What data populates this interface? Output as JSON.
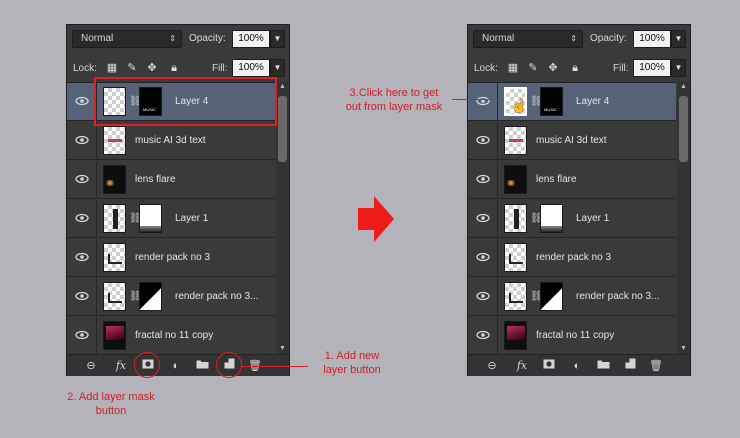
{
  "colors": {
    "annotation": "#dd1f26",
    "panel_bg": "#3a3a3a",
    "selected_row": "#566278"
  },
  "panel": {
    "blend_mode": "Normal",
    "opacity_label": "Opacity:",
    "opacity_value": "100%",
    "lock_label": "Lock:",
    "fill_label": "Fill:",
    "fill_value": "100%",
    "lock_icons": [
      "lock-transparent-pixels-icon",
      "lock-image-pixels-icon",
      "lock-position-icon",
      "lock-all-icon"
    ],
    "footer_icons": [
      "link-layers-icon",
      "fx-icon",
      "add-layer-mask-icon",
      "adjustment-layer-icon",
      "new-group-icon",
      "new-layer-icon",
      "delete-layer-icon"
    ],
    "fx_label": "fx"
  },
  "layers": [
    {
      "name": "Layer 4",
      "selected": true,
      "has_mask": true,
      "thumb": "checker",
      "mask": "black"
    },
    {
      "name": "music AI 3d text",
      "selected": false,
      "has_mask": false,
      "thumb": "checker"
    },
    {
      "name": "lens flare",
      "selected": false,
      "has_mask": false,
      "thumb": "dark"
    },
    {
      "name": "Layer 1",
      "selected": false,
      "has_mask": true,
      "thumb": "checker",
      "mask": "white"
    },
    {
      "name": "render pack no 3",
      "selected": false,
      "has_mask": false,
      "thumb": "checker"
    },
    {
      "name": "render pack no 3...",
      "selected": false,
      "has_mask": true,
      "thumb": "checker",
      "mask": "white"
    },
    {
      "name": "fractal no 11 copy",
      "selected": false,
      "has_mask": false,
      "thumb": "dark"
    }
  ],
  "annotations": {
    "add_new_layer": "1. Add new\nlayer button",
    "add_layer_mask": "2. Add layer mask\nbutton",
    "click_here": "3.Click here to get\nout from layer mask"
  },
  "thumbnail_text": {
    "mask_word": "MUSIC"
  }
}
